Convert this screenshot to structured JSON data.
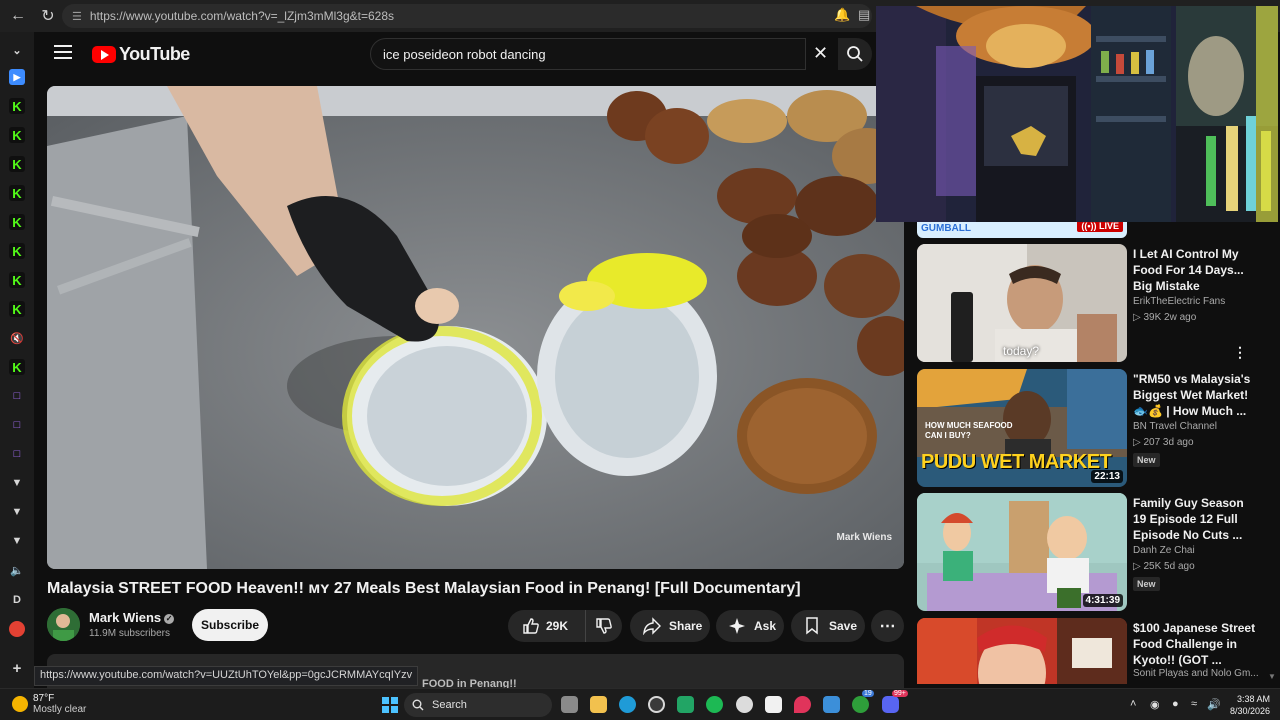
{
  "browser": {
    "url": "https://www.youtube.com/watch?v=_lZjm3mMl3g&t=628s",
    "hover_link": "https://www.youtube.com/watch?v=UUZtUhTOYel&pp=0gcJCRMMAYcqIYzv"
  },
  "header": {
    "logo_text": "YouTube",
    "search_query": "ice poseideon robot dancing"
  },
  "video": {
    "title": "Malaysia STREET FOOD Heaven!! ᴍʏ 27 Meals Best Malaysian Food in Penang! [Full Documentary]",
    "watermark": "Mark Wiens",
    "channel": "Mark Wiens",
    "subscribers": "11.9M subscribers",
    "subscribe_label": "Subscribe",
    "likes": "29K",
    "share_label": "Share",
    "ask_label": "Ask",
    "save_label": "Save",
    "description_peek": "FOOD in Penang!!"
  },
  "cam": {
    "live_label": "LIVE",
    "banner_text": "GUMBALL"
  },
  "recommended": [
    {
      "title": "I Let AI Control My Food For 14 Days... Big Mistake",
      "channel": "ErikTheElectric Fans",
      "meta": "▷ 39K  2w ago",
      "caption": "today?",
      "new": ""
    },
    {
      "title": "\"RM50 vs Malaysia's Biggest Wet Market! 🐟💰 | How Much ...",
      "channel": "BN Travel Channel",
      "meta": "▷ 207  3d ago",
      "duration": "22:13",
      "thumb_text": "PUDU WET MARKET",
      "thumb_subtext": "HOW MUCH SEAFOOD CAN I BUY?",
      "new": "New"
    },
    {
      "title": "Family Guy Season 19 Episode 12 Full Episode No Cuts ...",
      "channel": "Danh Ze Chai",
      "meta": "▷ 25K  5d ago",
      "duration": "4:31:39",
      "new": "New"
    },
    {
      "title": "$100 Japanese Street Food Challenge in Kyoto!! (GOT ...",
      "channel": "Sonit Playas and Nolo Gm...",
      "meta": "",
      "new": ""
    }
  ],
  "taskbar": {
    "temperature": "87°F",
    "weather": "Mostly clear",
    "search_label": "Search",
    "time": "3:38 AM",
    "date": "8/30/2026",
    "xbox_badge": "19",
    "discord_badge": "99+"
  },
  "colors": {
    "background": "#0f0f0f",
    "youtube_red": "#ff0000",
    "kick_green": "#53fc18",
    "twitch_purple": "#a970ff",
    "pudu_yellow": "#ffd21e"
  }
}
